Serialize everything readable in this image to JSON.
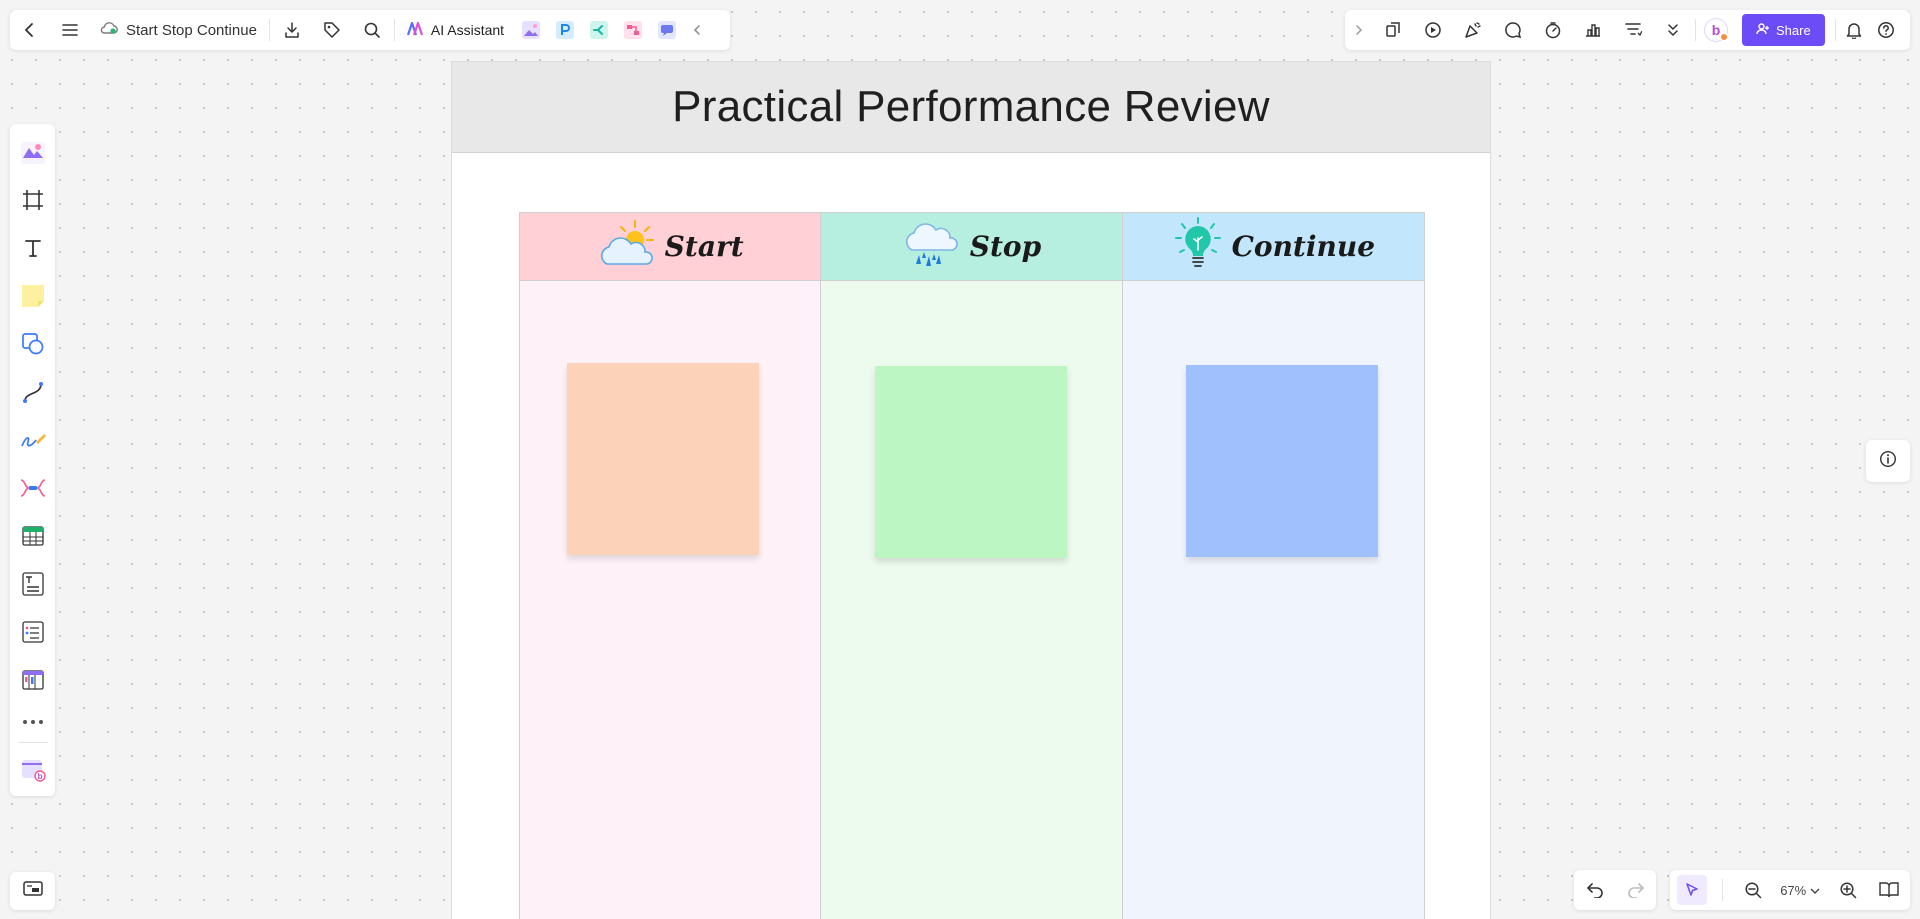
{
  "app": {
    "document_title": "Start Stop Continue",
    "ai_assistant_label": "AI Assistant",
    "share_label": "Share",
    "avatar_letter": "b",
    "zoom_level": "67%"
  },
  "board": {
    "title": "Practical Performance Review",
    "columns": [
      {
        "label": "Start",
        "head_color": "#ffd0d6",
        "body_color": "#fef2f8",
        "sticky_color": "#fcd2b8",
        "icon": "sun-cloud-icon"
      },
      {
        "label": "Stop",
        "head_color": "#b6efdf",
        "body_color": "#edfaee",
        "sticky_color": "#bcf7c3",
        "icon": "rain-cloud-icon"
      },
      {
        "label": "Continue",
        "head_color": "#c2e6fb",
        "body_color": "#f0f5fd",
        "sticky_color": "#a0bffd",
        "icon": "lightbulb-icon"
      }
    ]
  },
  "colors": {
    "accent": "#6c4cf6",
    "canvas_bg": "#f4f4f5"
  }
}
